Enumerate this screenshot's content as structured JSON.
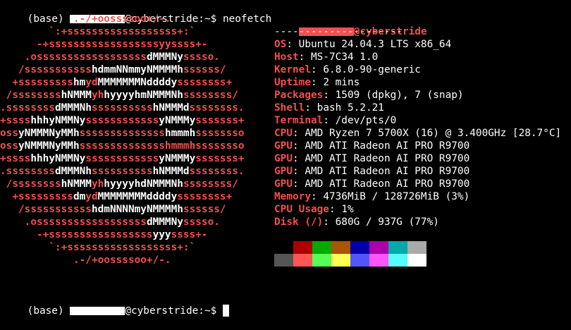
{
  "prompt": {
    "env": "(base) ",
    "host_suffix": "@cyberstride:~$ ",
    "command": "neofetch"
  },
  "logo": [
    [
      [
        "r",
        "            .-/+oossssoo+/-."
      ]
    ],
    [
      [
        "r",
        "        `:+ssssssssssssssssss+:`"
      ]
    ],
    [
      [
        "r",
        "      -+ssssssssssssssssssyyssss+-"
      ]
    ],
    [
      [
        "r",
        "    .ossssssssssssssssss"
      ],
      [
        "w",
        "dMMMNy"
      ],
      [
        "r",
        "sssso."
      ]
    ],
    [
      [
        "r",
        "   /sssssssssss"
      ],
      [
        "w",
        "hdmmNNmmyNMMMMh"
      ],
      [
        "r",
        "ssssss/"
      ]
    ],
    [
      [
        "r",
        "  +sssssssss"
      ],
      [
        "w",
        "hm"
      ],
      [
        "r",
        "yd"
      ],
      [
        "w",
        "MMMMMMMNddddy"
      ],
      [
        "r",
        "ssssssss+"
      ]
    ],
    [
      [
        "r",
        " /ssssssss"
      ],
      [
        "w",
        "hNMMM"
      ],
      [
        "r",
        "yh"
      ],
      [
        "w",
        "hyyyyhmNMMMNh"
      ],
      [
        "r",
        "ssssssss/"
      ]
    ],
    [
      [
        "r",
        ".ssssssss"
      ],
      [
        "w",
        "dMMMNh"
      ],
      [
        "r",
        "ssssssssss"
      ],
      [
        "w",
        "hNMMMd"
      ],
      [
        "r",
        "ssssssss."
      ]
    ],
    [
      [
        "r",
        "+ssss"
      ],
      [
        "w",
        "hhhyNMMNy"
      ],
      [
        "r",
        "ssssssssssss"
      ],
      [
        "w",
        "yNMMMy"
      ],
      [
        "r",
        "sssssss+"
      ]
    ],
    [
      [
        "r",
        "oss"
      ],
      [
        "w",
        "yNMMMNyMMh"
      ],
      [
        "r",
        "ssssssssssssss"
      ],
      [
        "w",
        "hmmmh"
      ],
      [
        "r",
        "ssssssso"
      ]
    ],
    [
      [
        "r",
        "oss"
      ],
      [
        "w",
        "yNMMMNyMMh"
      ],
      [
        "r",
        "sssssssssssssshmmmhssssssso"
      ]
    ],
    [
      [
        "r",
        "+ssss"
      ],
      [
        "w",
        "hhhyNMMNy"
      ],
      [
        "r",
        "ssssssssssss"
      ],
      [
        "w",
        "yNMMMy"
      ],
      [
        "r",
        "sssssss+"
      ]
    ],
    [
      [
        "r",
        ".ssssssss"
      ],
      [
        "w",
        "dMMMNh"
      ],
      [
        "r",
        "ssssssssss"
      ],
      [
        "w",
        "hNMMMd"
      ],
      [
        "r",
        "ssssssss."
      ]
    ],
    [
      [
        "r",
        " /ssssssss"
      ],
      [
        "w",
        "hNMMM"
      ],
      [
        "r",
        "yh"
      ],
      [
        "w",
        "hyyyyhdNMMMNh"
      ],
      [
        "r",
        "ssssssss/"
      ]
    ],
    [
      [
        "r",
        "  +sssssssss"
      ],
      [
        "w",
        "dm"
      ],
      [
        "r",
        "yd"
      ],
      [
        "w",
        "MMMMMMMMddddy"
      ],
      [
        "r",
        "ssssssss+"
      ]
    ],
    [
      [
        "r",
        "   /sssssssssss"
      ],
      [
        "w",
        "hdmNNNNmyNMMMMh"
      ],
      [
        "r",
        "ssssss/"
      ]
    ],
    [
      [
        "r",
        "    .ossssssssssssssssss"
      ],
      [
        "w",
        "dMMMNy"
      ],
      [
        "r",
        "sssso."
      ]
    ],
    [
      [
        "r",
        "      -+sssssssssssssssss"
      ],
      [
        "w",
        "yyy"
      ],
      [
        "r",
        "ssss+-"
      ]
    ],
    [
      [
        "r",
        "        `:+ssssssssssssssssss+:`"
      ]
    ],
    [
      [
        "r",
        "            .-/+oossssoo+/-."
      ]
    ]
  ],
  "info": {
    "user_host_suffix": "@cyberstride",
    "separator": "---------------------",
    "rows": [
      {
        "key": "OS",
        "value": "Ubuntu 24.04.3 LTS x86_64"
      },
      {
        "key": "Host",
        "value": "MS-7C34 1.0"
      },
      {
        "key": "Kernel",
        "value": "6.8.0-90-generic"
      },
      {
        "key": "Uptime",
        "value": "2 mins"
      },
      {
        "key": "Packages",
        "value": "1509 (dpkg), 7 (snap)"
      },
      {
        "key": "Shell",
        "value": "bash 5.2.21"
      },
      {
        "key": "Terminal",
        "value": "/dev/pts/0"
      },
      {
        "key": "CPU",
        "value": "AMD Ryzen 7 5700X (16) @ 3.400GHz [28.7°C]"
      },
      {
        "key": "GPU",
        "value": "AMD ATI Radeon AI PRO R9700"
      },
      {
        "key": "GPU",
        "value": "AMD ATI Radeon AI PRO R9700"
      },
      {
        "key": "GPU",
        "value": "AMD ATI Radeon AI PRO R9700"
      },
      {
        "key": "GPU",
        "value": "AMD ATI Radeon AI PRO R9700"
      },
      {
        "key": "Memory",
        "value": "4736MiB / 128726MiB (3%)"
      },
      {
        "key": "CPU Usage",
        "value": "1%"
      },
      {
        "key": "Disk (/)",
        "value": "680G / 937G (77%)"
      }
    ]
  },
  "palette": {
    "normal": [
      "#000000",
      "#aa0000",
      "#00aa00",
      "#aa5500",
      "#0000aa",
      "#aa00aa",
      "#00aaaa",
      "#aaaaaa"
    ],
    "bright": [
      "#555555",
      "#ff5555",
      "#55ff55",
      "#ffff55",
      "#5555ff",
      "#ff55ff",
      "#55ffff",
      "#ffffff"
    ]
  }
}
